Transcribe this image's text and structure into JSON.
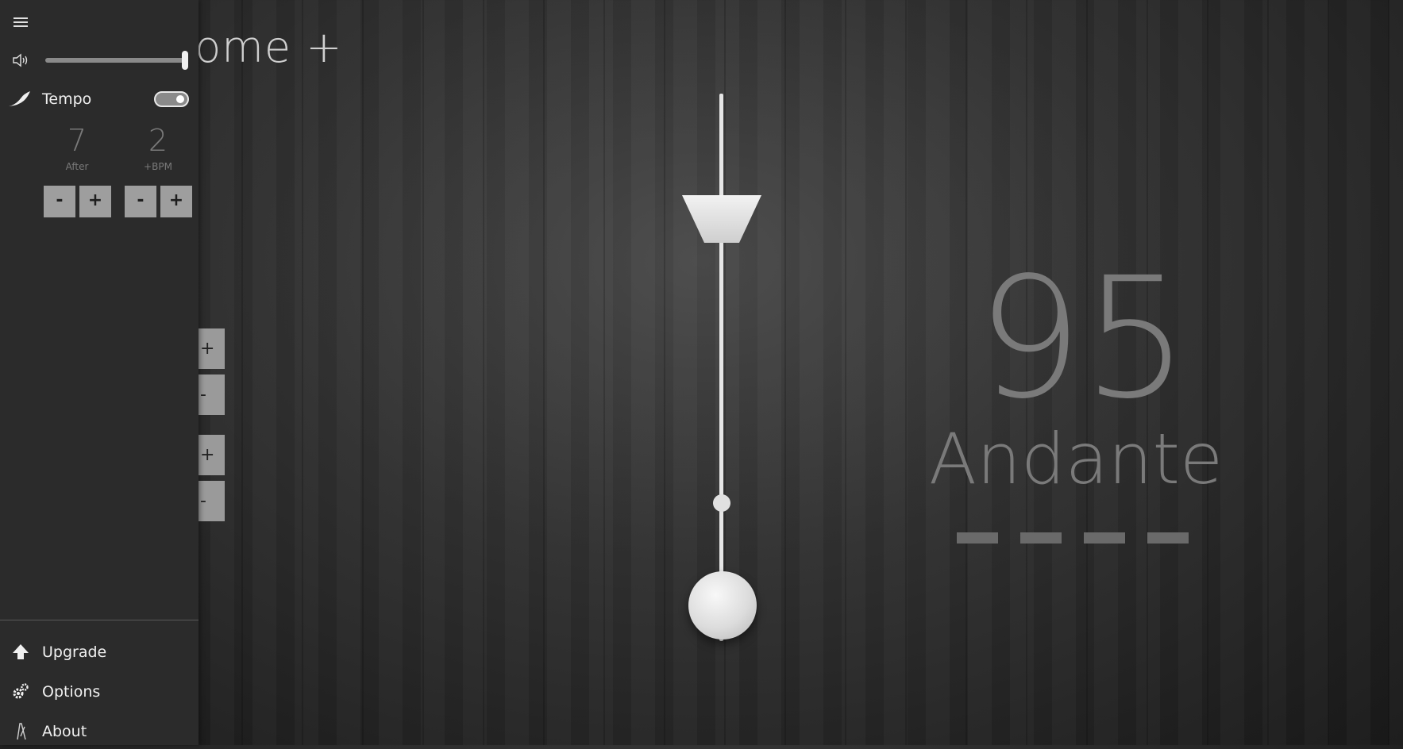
{
  "app": {
    "title_visible": "nome +"
  },
  "pendulum": {
    "bpm": "95",
    "marking": "Andante",
    "beat_count": 4
  },
  "side_adjust": {
    "plus": "+",
    "minus": "-"
  },
  "panel": {
    "volume": {
      "level": 1.0
    },
    "tempo": {
      "label": "Tempo",
      "enabled": true
    },
    "after": {
      "value": "7",
      "caption": "After"
    },
    "bpm_step": {
      "value": "2",
      "caption": "+BPM"
    },
    "buttons": {
      "minus": "-",
      "plus": "+"
    },
    "menu": [
      {
        "label": "Upgrade",
        "icon": "upgrade-arrow-icon"
      },
      {
        "label": "Options",
        "icon": "gears-icon"
      },
      {
        "label": "About",
        "icon": "metronome-icon"
      }
    ]
  },
  "colors": {
    "panel_bg": "#2b2b2b",
    "button_bg": "#9e9e9e",
    "display_text": "#7a7a7a"
  }
}
